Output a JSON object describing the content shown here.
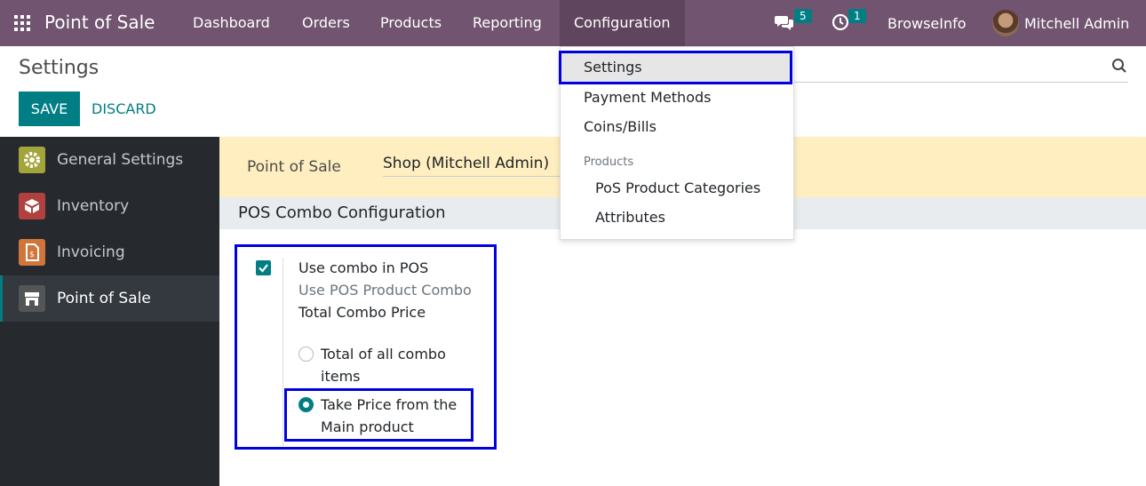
{
  "navbar": {
    "brand": "Point of Sale",
    "items": [
      "Dashboard",
      "Orders",
      "Products",
      "Reporting",
      "Configuration"
    ],
    "messages_count": "5",
    "activities_count": "1",
    "company": "BrowseInfo",
    "user": "Mitchell Admin"
  },
  "control": {
    "title": "Settings",
    "save_label": "SAVE",
    "discard_label": "DISCARD"
  },
  "sidebar": {
    "items": [
      {
        "label": "General Settings",
        "color": "#a3a53a"
      },
      {
        "label": "Inventory",
        "color": "#b0413e"
      },
      {
        "label": "Invoicing",
        "color": "#d2753a"
      },
      {
        "label": "Point of Sale",
        "color": "#555555"
      }
    ]
  },
  "main": {
    "company_label": "Point of Sale",
    "company_value": "Shop (Mitchell Admin)",
    "section_title": "POS Combo Configuration",
    "combo_title": "Use combo in POS",
    "combo_desc": "Use POS Product Combo",
    "combo_sub": "Total Combo Price",
    "radio_1": "Total of all combo items",
    "radio_2": "Take Price from the Main product"
  },
  "dropdown": {
    "settings": "Settings",
    "payment_methods": "Payment Methods",
    "coins_bills": "Coins/Bills",
    "products_header": "Products",
    "pos_categories": "PoS Product Categories",
    "attributes": "Attributes"
  },
  "colors": {
    "navbar": "#71546f",
    "accent": "#017e84",
    "highlight": "#0000e0"
  }
}
